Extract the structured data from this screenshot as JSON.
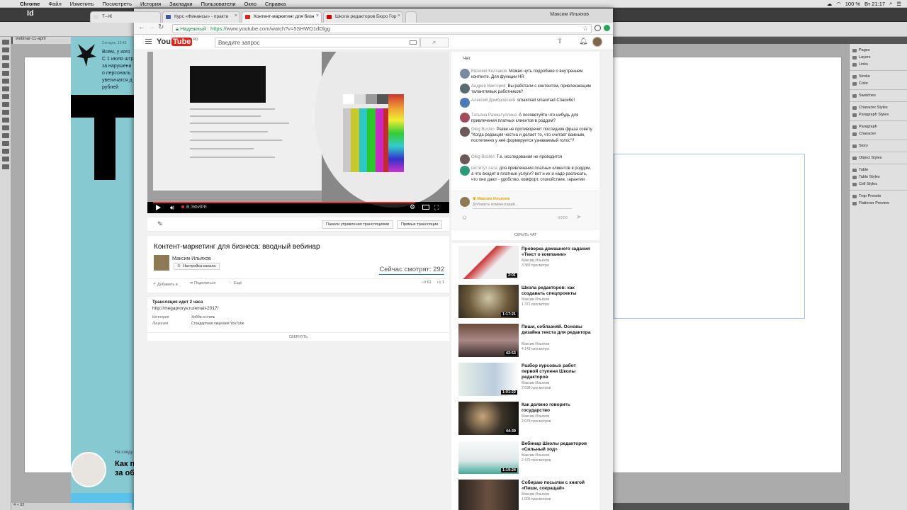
{
  "macos": {
    "app": "Chrome",
    "menus": [
      "Файл",
      "Изменить",
      "Посмотреть",
      "История",
      "Закладки",
      "Пользователи",
      "Окно",
      "Справка"
    ],
    "battery": "100 %",
    "time": "Вт 21:17"
  },
  "indesign": {
    "app_label": "Id",
    "doc_tab": "webinar-11-april",
    "status": "4 ÷ 32",
    "zoom": "Tau",
    "panel": [
      "Pages",
      "Layers",
      "Links",
      "Stroke",
      "Color",
      "Swatches",
      "Character Styles",
      "Paragraph Styles",
      "Paragraph",
      "Character",
      "Story",
      "Object Styles",
      "Table",
      "Table Styles",
      "Cell Styles",
      "Trap Presets",
      "Flattener Preview"
    ],
    "page": {
      "date": "Сегодня, 16:45",
      "lines": [
        "Всем, у кого",
        "С 1 июля штр",
        "за нарушени",
        "о персональ",
        "увеличатся д",
        "рублей"
      ],
      "next": "На следу",
      "howto": [
        "Как п",
        "за об"
      ]
    }
  },
  "browser": {
    "tabs": [
      {
        "label": "Т--Ж",
        "fav": "#ddd"
      },
      {
        "label": "Курс «Финансы» - практи",
        "fav": "#3b5998"
      },
      {
        "label": "Контент-маркетинг для бизн",
        "fav": "#e62117"
      },
      {
        "label": "Школа редакторов Бюро Гор",
        "fav": "#c00"
      }
    ],
    "profile": "Максим Ильяхов",
    "url": {
      "secure": "Надежный",
      "scheme": "https://",
      "rest": "www.youtube.com/watch?v=5SHWO1dOlgg"
    }
  },
  "youtube": {
    "logo": {
      "you": "You",
      "tube": "Tube",
      "region": "RU"
    },
    "search_placeholder": "Введите запрос",
    "player": {
      "live": "В ЭФИРЕ"
    },
    "actions": {
      "dashboard": "Панели управления трансляциями",
      "live": "Прямые трансляции"
    },
    "video": {
      "title": "Контент-маркетинг для бизнеса: вводный вебинар",
      "channel": "Максим Ильяхов",
      "channel_settings": "Настройка канала",
      "viewers": "Сейчас смотрят: 292",
      "add": "Добавить в",
      "share": "Поделиться",
      "more": "Ещё",
      "likes": "61",
      "dislikes": "1"
    },
    "description": {
      "status": "Трансляция идет 2 часа",
      "link": "http://megaproryv.ru/email-2017/",
      "category_label": "Категория",
      "category": "Хобби и стиль",
      "license_label": "Лицензия",
      "license": "Стандартная лицензия YouTube",
      "collapse": "СВЕРНУТЬ"
    },
    "chat": {
      "title": "Чат",
      "messages": [
        {
          "name": "Евгений Колпаков",
          "text": "Можно чуть подробнее о внутреннем контенте. Для функции HR",
          "color": "#7a8aa0"
        },
        {
          "name": "Андрей Викторов",
          "text": "Вы работали с контентом, привлекающим талантливых работников?",
          "color": "#5a6a70"
        },
        {
          "name": "Алексей Домбровский",
          "text": "smaxmad smaxmad Спасибо!",
          "color": "#4a7ab8"
        },
        {
          "name": "Татьяна Рахматуллина",
          "text": "А посоветуйте что-нибудь для привлечения платных клиентов в роддом?",
          "color": "#a04a5a"
        },
        {
          "name": "Oleg Bushin",
          "text": "Разве не противоречит последняя фраза совету \"Когда редакция честна и делает то, что считает важным, постепенно у неё формируется узнаваемый голос\"?",
          "color": "#6a5a5a"
        },
        {
          "name": "Oleg Bushin",
          "text": "Т.е. исследования не проводится",
          "color": "#6a5a5a"
        },
        {
          "name": "Інститут пата",
          "text": "для привлечения платных клиентов в роддом, а что входит в платные услуги? вот и их и надо расписать, что они дают - удобство, комфорт, спокойствие, гарантии",
          "color": "#2a9a7a"
        }
      ],
      "me": "Максим Ильяхов",
      "placeholder": "Добавить комментарий...",
      "counter": "0/200",
      "hide": "СКРЫТЬ ЧАТ"
    },
    "related": [
      {
        "title": "Проверка домашнего задания «Текст о компании»",
        "channel": "Максим Ильяхов",
        "views": "3 383 просмотра",
        "duration": "2:01"
      },
      {
        "title": "Школа редакторов: как создавать спецпроекты",
        "channel": "Максим Ильяхов",
        "views": "1 372 просмотра",
        "duration": "1:17:21"
      },
      {
        "title": "Пиши, соблазняй. Основы дизайна текста для редактора",
        "channel": "Максим Ильяхов",
        "views": "4 143 просмотра",
        "duration": "42:53"
      },
      {
        "title": "Разбор курсовых работ первой ступени Школы редакторов",
        "channel": "Максим Ильяхов",
        "views": "2 638 просмотров",
        "duration": "1:01:22"
      },
      {
        "title": "Как должно говорить государство",
        "channel": "Максим Ильяхов",
        "views": "2 978 просмотров",
        "duration": "44:39"
      },
      {
        "title": "Вебинар Школы редакторов «Сильный ход»",
        "channel": "Максим Ильяхов",
        "views": "2 475 просмотров",
        "duration": "1:19:24"
      },
      {
        "title": "Собираю посылки с книгой «Пиши, сокращай»",
        "channel": "Максим Ильяхов",
        "views": "1 005 просмотров",
        "duration": ""
      }
    ]
  }
}
